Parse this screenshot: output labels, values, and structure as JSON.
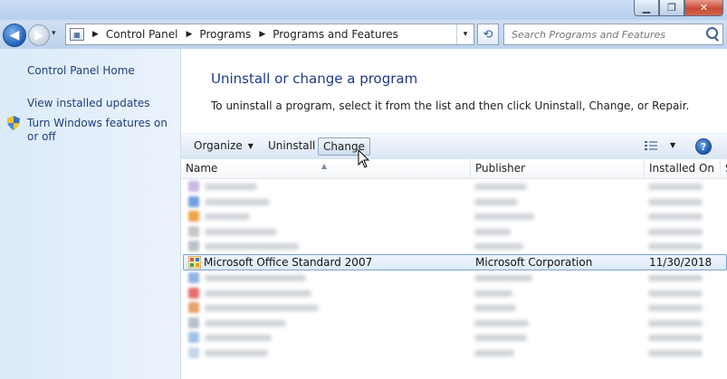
{
  "window": {
    "minimize_glyph": "▁",
    "maximize_glyph": "❐",
    "close_glyph": "✕"
  },
  "nav": {
    "back_glyph": "◀",
    "forward_glyph": "▶",
    "dropdown_glyph": "▾",
    "refresh_glyph": "⟲"
  },
  "address": {
    "breadcrumbs": [
      "Control Panel",
      "Programs",
      "Programs and Features"
    ],
    "separator": "▶",
    "dropdown_glyph": "▾"
  },
  "search": {
    "placeholder": "Search Programs and Features"
  },
  "sidebar": {
    "items": [
      {
        "label": "Control Panel Home"
      },
      {
        "label": "View installed updates"
      },
      {
        "label": "Turn Windows features on or off"
      }
    ]
  },
  "main": {
    "title": "Uninstall or change a program",
    "description": "To uninstall a program, select it from the list and then click Uninstall, Change, or Repair."
  },
  "toolbar": {
    "organize_label": "Organize",
    "organize_caret": "▼",
    "uninstall_label": "Uninstall",
    "change_label": "Change",
    "views_caret": "▼",
    "help_glyph": "?"
  },
  "list": {
    "columns": [
      "Name",
      "Publisher",
      "Installed On",
      "S"
    ],
    "sort_glyph": "▲",
    "selected_row": {
      "name": "Microsoft Office Standard 2007",
      "publisher": "Microsoft Corporation",
      "installed_on": "11/30/2018"
    },
    "blurred_row_icon_colors": [
      "#c9b7e6",
      "#6f9fe0",
      "#f0a24a",
      "#c7c7cc",
      "#b9c1cc",
      "#8fb3e8",
      "#e86c6c",
      "#e8a06c",
      "#b7c1cc",
      "#9fc0e8",
      "#c7d6ea"
    ],
    "blurred_rows_above": 5,
    "blurred_rows_below": 6
  },
  "colors": {
    "link": "#1e3f7a",
    "title": "#1e3a8a",
    "sidebar_bg": "#dcebfa",
    "selection_border": "#7da2ce"
  }
}
